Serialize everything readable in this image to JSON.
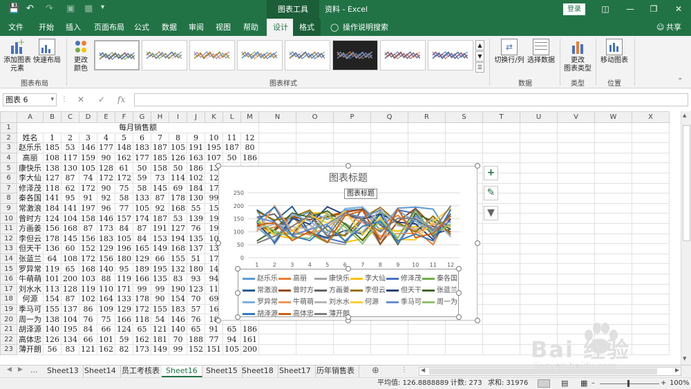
{
  "titlebar": {
    "context_group": "图表工具",
    "doc_title": "资料 - Excel",
    "login": "登录"
  },
  "tabs": [
    "文件",
    "开始",
    "插入",
    "页面布局",
    "公式",
    "数据",
    "审阅",
    "视图",
    "帮助",
    "设计",
    "格式"
  ],
  "tell_me": "操作说明搜索",
  "share": "共享",
  "ribbon": {
    "add_element": "添加图表\n元素",
    "quick_layout": "快速布局",
    "group_layout": "图表布局",
    "change_colors": "更改\n颜色",
    "group_styles": "图表样式",
    "switch_row_col": "切换行/列",
    "select_data": "选择数据",
    "group_data": "数据",
    "change_type": "更改\n图表类型",
    "group_type": "类型",
    "move_chart": "移动图表",
    "group_location": "位置"
  },
  "formula": {
    "namebox": "图表 6",
    "fx": "fx"
  },
  "columns": [
    "A",
    "B",
    "C",
    "D",
    "E",
    "F",
    "G",
    "H",
    "I",
    "J",
    "K",
    "L",
    "M",
    "N",
    "O",
    "P",
    "Q",
    "R",
    "S",
    "T",
    "U",
    "V",
    "W",
    "X"
  ],
  "title_row": "每月销售额",
  "header_row": [
    "姓名",
    "1",
    "2",
    "3",
    "4",
    "5",
    "6",
    "7",
    "8",
    "9",
    "10",
    "11",
    "12"
  ],
  "rows": [
    [
      "赵乐乐",
      "185",
      "53",
      "146",
      "177",
      "148",
      "183",
      "187",
      "105",
      "191",
      "195",
      "187",
      "80"
    ],
    [
      "高丽",
      "108",
      "117",
      "159",
      "90",
      "162",
      "177",
      "185",
      "126",
      "163",
      "107",
      "50",
      "186"
    ],
    [
      "康快乐",
      "138",
      "130",
      "105",
      "128",
      "61",
      "50",
      "158",
      "50",
      "186",
      "13",
      "",
      ""
    ],
    [
      "李大仙",
      "127",
      "87",
      "74",
      "172",
      "172",
      "59",
      "73",
      "114",
      "102",
      "12",
      "",
      ""
    ],
    [
      "修泽茂",
      "118",
      "62",
      "172",
      "90",
      "75",
      "58",
      "145",
      "69",
      "184",
      "17",
      "",
      ""
    ],
    [
      "秦各国",
      "141",
      "95",
      "91",
      "92",
      "58",
      "133",
      "87",
      "178",
      "130",
      "99",
      "",
      ""
    ],
    [
      "常激浪",
      "184",
      "141",
      "197",
      "96",
      "77",
      "105",
      "92",
      "168",
      "55",
      "15",
      "",
      ""
    ],
    [
      "曾时方",
      "124",
      "104",
      "158",
      "146",
      "157",
      "174",
      "187",
      "53",
      "139",
      "19",
      "",
      ""
    ],
    [
      "方画姜",
      "156",
      "168",
      "87",
      "173",
      "84",
      "87",
      "191",
      "127",
      "76",
      "19",
      "",
      ""
    ],
    [
      "李但云",
      "178",
      "145",
      "156",
      "183",
      "105",
      "84",
      "153",
      "194",
      "135",
      "10",
      "",
      ""
    ],
    [
      "但天干",
      "136",
      "60",
      "152",
      "129",
      "196",
      "165",
      "149",
      "168",
      "137",
      "13",
      "",
      ""
    ],
    [
      "张蓝兰",
      "64",
      "108",
      "172",
      "156",
      "180",
      "129",
      "66",
      "155",
      "51",
      "17",
      "",
      ""
    ],
    [
      "罗异常",
      "119",
      "65",
      "168",
      "140",
      "95",
      "189",
      "195",
      "132",
      "180",
      "14",
      "",
      ""
    ],
    [
      "牛萌萌",
      "101",
      "200",
      "103",
      "88",
      "119",
      "166",
      "135",
      "83",
      "93",
      "94",
      "",
      ""
    ],
    [
      "刘水水",
      "113",
      "128",
      "119",
      "110",
      "171",
      "99",
      "99",
      "190",
      "123",
      "11",
      "",
      ""
    ],
    [
      "何源",
      "154",
      "87",
      "102",
      "164",
      "133",
      "178",
      "90",
      "154",
      "70",
      "69",
      "",
      ""
    ],
    [
      "季马可",
      "155",
      "137",
      "86",
      "109",
      "129",
      "172",
      "155",
      "183",
      "57",
      "16",
      "",
      ""
    ],
    [
      "周一为",
      "138",
      "104",
      "76",
      "75",
      "166",
      "118",
      "54",
      "146",
      "76",
      "18",
      "",
      ""
    ],
    [
      "胡泽源",
      "140",
      "195",
      "84",
      "66",
      "124",
      "65",
      "121",
      "140",
      "65",
      "91",
      "65",
      "186"
    ],
    [
      "高体忠",
      "126",
      "134",
      "66",
      "101",
      "59",
      "162",
      "181",
      "70",
      "188",
      "77",
      "94",
      "161"
    ],
    [
      "薄开朗",
      "56",
      "83",
      "121",
      "162",
      "82",
      "173",
      "149",
      "99",
      "152",
      "151",
      "105",
      "200"
    ]
  ],
  "chart_data": {
    "type": "line",
    "title": "图表标题",
    "tooltip": "图表标题",
    "x": [
      "1",
      "2",
      "3",
      "4",
      "5",
      "6",
      "7",
      "8",
      "9",
      "10",
      "11",
      "12"
    ],
    "y_ticks": [
      "250",
      "200",
      "150",
      "100",
      "50",
      "0"
    ],
    "ylim": [
      0,
      250
    ],
    "series": [
      {
        "name": "赵乐乐",
        "color": "#5b9bd5",
        "values": [
          185,
          53,
          146,
          177,
          148,
          183,
          187,
          105,
          191,
          195,
          187,
          80
        ]
      },
      {
        "name": "高丽",
        "color": "#ed7d31",
        "values": [
          108,
          117,
          159,
          90,
          162,
          177,
          185,
          126,
          163,
          107,
          50,
          186
        ]
      },
      {
        "name": "康快乐",
        "color": "#a5a5a5",
        "values": [
          138,
          130,
          105,
          128,
          61,
          50,
          158,
          50,
          186,
          130,
          120,
          150
        ]
      },
      {
        "name": "李大仙",
        "color": "#ffc000",
        "values": [
          127,
          87,
          74,
          172,
          172,
          59,
          73,
          114,
          102,
          120,
          110,
          140
        ]
      },
      {
        "name": "修泽茂",
        "color": "#4472c4",
        "values": [
          118,
          62,
          172,
          90,
          75,
          58,
          145,
          69,
          184,
          170,
          100,
          130
        ]
      },
      {
        "name": "秦各国",
        "color": "#70ad47",
        "values": [
          141,
          95,
          91,
          92,
          58,
          133,
          87,
          178,
          130,
          99,
          150,
          120
        ]
      },
      {
        "name": "常激浪",
        "color": "#255e91",
        "values": [
          184,
          141,
          197,
          96,
          77,
          105,
          92,
          168,
          55,
          150,
          90,
          110
        ]
      },
      {
        "name": "曾时方",
        "color": "#9e480e",
        "values": [
          124,
          104,
          158,
          146,
          157,
          174,
          187,
          53,
          139,
          190,
          120,
          100
        ]
      },
      {
        "name": "方画姜",
        "color": "#636363",
        "values": [
          156,
          168,
          87,
          173,
          84,
          87,
          191,
          127,
          76,
          190,
          80,
          170
        ]
      },
      {
        "name": "李但云",
        "color": "#997300",
        "values": [
          178,
          145,
          156,
          183,
          105,
          84,
          153,
          194,
          135,
          100,
          160,
          90
        ]
      },
      {
        "name": "但天干",
        "color": "#264478",
        "values": [
          136,
          60,
          152,
          129,
          196,
          165,
          149,
          168,
          137,
          130,
          70,
          150
        ]
      },
      {
        "name": "张蓝兰",
        "color": "#43682b",
        "values": [
          64,
          108,
          172,
          156,
          180,
          129,
          66,
          155,
          51,
          170,
          140,
          110
        ]
      },
      {
        "name": "罗异常",
        "color": "#7cafdd",
        "values": [
          119,
          65,
          168,
          140,
          95,
          189,
          195,
          132,
          180,
          140,
          100,
          160
        ]
      },
      {
        "name": "牛萌萌",
        "color": "#f1975a",
        "values": [
          101,
          200,
          103,
          88,
          119,
          166,
          135,
          83,
          93,
          94,
          130,
          120
        ]
      },
      {
        "name": "刘水水",
        "color": "#b7b7b7",
        "values": [
          113,
          128,
          119,
          110,
          171,
          99,
          99,
          190,
          123,
          110,
          150,
          80
        ]
      },
      {
        "name": "何源",
        "color": "#ffcd33",
        "values": [
          154,
          87,
          102,
          164,
          133,
          178,
          90,
          154,
          70,
          69,
          140,
          190
        ]
      },
      {
        "name": "季马可",
        "color": "#698ed0",
        "values": [
          155,
          137,
          86,
          109,
          129,
          172,
          155,
          183,
          57,
          160,
          110,
          140
        ]
      },
      {
        "name": "周一为",
        "color": "#8cc168",
        "values": [
          138,
          104,
          76,
          75,
          166,
          118,
          54,
          146,
          76,
          180,
          90,
          130
        ]
      },
      {
        "name": "胡泽源",
        "color": "#327dc2",
        "values": [
          140,
          195,
          84,
          66,
          124,
          65,
          121,
          140,
          65,
          91,
          65,
          186
        ]
      },
      {
        "name": "高体忠",
        "color": "#d26012",
        "values": [
          126,
          134,
          66,
          101,
          59,
          162,
          181,
          70,
          188,
          77,
          94,
          161
        ]
      },
      {
        "name": "薄开朗",
        "color": "#7f7f7f",
        "values": [
          56,
          83,
          121,
          162,
          82,
          173,
          149,
          99,
          152,
          151,
          105,
          200
        ]
      }
    ]
  },
  "sheet_tabs": [
    "Sheet13",
    "Sheet14",
    "员工考核表",
    "Sheet16",
    "Sheet15",
    "Sheet18",
    "Sheet17",
    "历年销售表"
  ],
  "active_sheet": "Sheet16",
  "status": {
    "average": "平均值: 126.8888889",
    "count": "计数: 273",
    "sum": "求和: 31976",
    "zoom": "100%"
  },
  "watermark": "Bai 经验",
  "watermark_url": "jingyan.baidu.com"
}
